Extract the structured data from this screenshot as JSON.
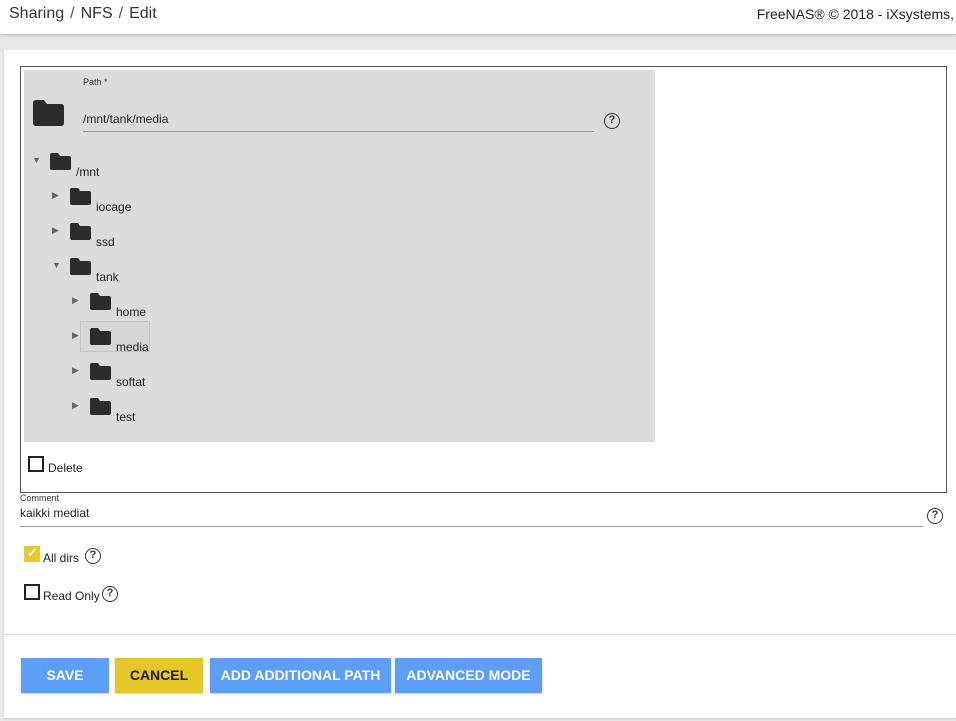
{
  "breadcrumb": {
    "items": [
      "Sharing",
      "NFS",
      "Edit"
    ],
    "separator": "/"
  },
  "header": {
    "copyright": "FreeNAS® © 2018 - iXsystems,"
  },
  "path_field": {
    "label": "Path *",
    "value": "/mnt/tank/media",
    "help_icon": "?"
  },
  "tree": {
    "nodes": [
      {
        "label": "/mnt",
        "expanded": true,
        "arrow": "▼"
      },
      {
        "label": "iocage",
        "expanded": false,
        "arrow": "▶"
      },
      {
        "label": "ssd",
        "expanded": false,
        "arrow": "▶"
      },
      {
        "label": "tank",
        "expanded": true,
        "arrow": "▼"
      },
      {
        "label": "home",
        "expanded": false,
        "arrow": "▶"
      },
      {
        "label": "media",
        "expanded": false,
        "arrow": "▶",
        "selected": true
      },
      {
        "label": "softat",
        "expanded": false,
        "arrow": "▶"
      },
      {
        "label": "test",
        "expanded": false,
        "arrow": "▶"
      }
    ]
  },
  "delete_checkbox": {
    "label": "Delete",
    "checked": false
  },
  "comment_field": {
    "label": "Comment",
    "value": "kaikki mediat",
    "help_icon": "?"
  },
  "all_dirs": {
    "label": "All dirs",
    "checked": true,
    "help_icon": "?"
  },
  "read_only": {
    "label": "Read Only",
    "checked": false,
    "help_icon": "?"
  },
  "buttons": {
    "save": "SAVE",
    "cancel": "CANCEL",
    "add_path": "ADD ADDITIONAL PATH",
    "advanced": "ADVANCED MODE"
  },
  "colors": {
    "primary": "#5d9ef7",
    "accent": "#e6c72a",
    "tree_bg": "#dcdcdc",
    "folder": "#2b2b2b"
  },
  "icons": {
    "folder": "folder-icon",
    "help": "help-circle-icon",
    "expand": "triangle-right-icon",
    "collapse": "triangle-down-icon",
    "check": "check-icon"
  }
}
